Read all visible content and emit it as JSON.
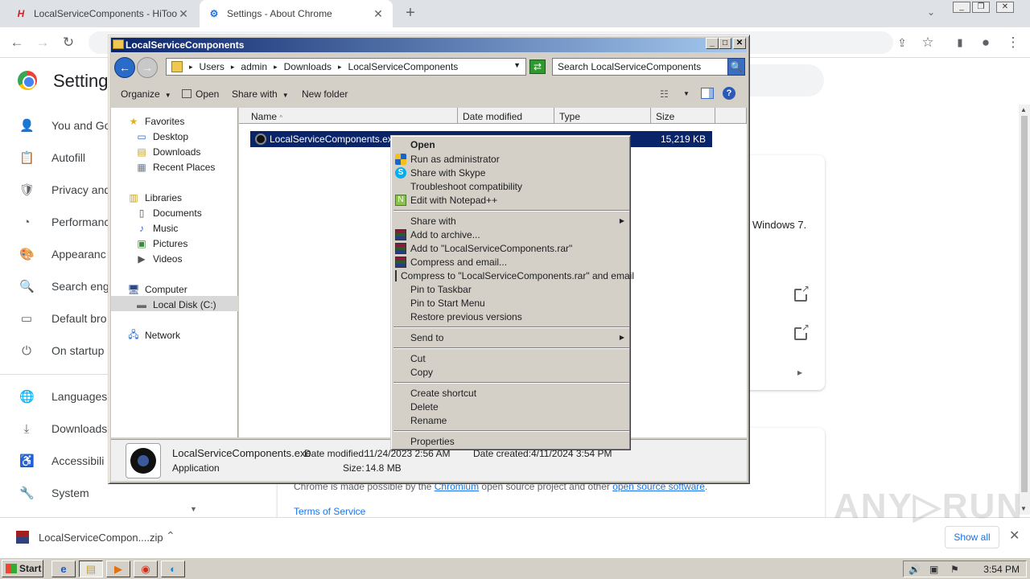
{
  "browser": {
    "tabs": [
      {
        "favicon": "H",
        "title": "LocalServiceComponents - HiTools - H",
        "close": "✕"
      },
      {
        "favicon": "⚙",
        "title": "Settings - About Chrome",
        "close": "✕"
      }
    ],
    "new_tab": "+",
    "tab_search": "⌄",
    "window_controls": [
      "_",
      "❐",
      "✕"
    ],
    "toolbar": {
      "back": "←",
      "forward": "→",
      "reload": "↻",
      "share": "⇪",
      "star": "☆",
      "sidebar": "▮",
      "profile": "●",
      "menu": "⋮"
    }
  },
  "settings": {
    "title": "Settings",
    "nav": [
      {
        "icon": "person-icon",
        "glyph": "👤",
        "label": "You and Go"
      },
      {
        "icon": "autofill-icon",
        "glyph": "📋",
        "label": "Autofill"
      },
      {
        "icon": "shield-icon",
        "glyph": "🛡",
        "label": "Privacy and"
      },
      {
        "icon": "gauge-icon",
        "glyph": "◔",
        "label": "Performanc"
      },
      {
        "icon": "palette-icon",
        "glyph": "🎨",
        "label": "Appearanc"
      },
      {
        "icon": "search-icon",
        "glyph": "🔍",
        "label": "Search eng"
      },
      {
        "icon": "browser-icon",
        "glyph": "▭",
        "label": "Default bro"
      },
      {
        "icon": "power-icon",
        "glyph": "⏻",
        "label": "On startup"
      },
      {
        "icon": "globe-icon",
        "glyph": "🌐",
        "label": "Languages"
      },
      {
        "icon": "download-icon",
        "glyph": "⤓",
        "label": "Downloads"
      },
      {
        "icon": "accessibility-icon",
        "glyph": "♿",
        "label": "Accessibili"
      },
      {
        "icon": "wrench-icon",
        "glyph": "🔧",
        "label": "System"
      }
    ],
    "nav_scroll_arrow": "▼",
    "about_partial": "Windows 7.",
    "footer_prefix": "Chrome is made possible by the ",
    "footer_link1": "Chromium",
    "footer_middle": " open source project and other ",
    "footer_link2": "open source software",
    "footer_suffix": ".",
    "terms": "Terms of Service",
    "chevron": "▸"
  },
  "download_bar": {
    "filename": "LocalServiceCompon....zip",
    "chevron": "⌃",
    "show_all": "Show all",
    "close": "✕"
  },
  "watermark": "ANY▷RUN",
  "explorer": {
    "title": "LocalServiceComponents",
    "window_buttons": [
      "_",
      "□",
      "✕"
    ],
    "back": "←",
    "forward": "→",
    "breadcrumb": [
      "Users",
      "admin",
      "Downloads",
      "LocalServiceComponents"
    ],
    "crumb_sep": "▸",
    "addr_dropdown": "▼",
    "refresh": "⇄",
    "search_placeholder": "Search LocalServiceComponents",
    "search_btn": "🔍",
    "commands": {
      "organize": "Organize",
      "open": "Open",
      "share_with": "Share with",
      "new_folder": "New folder",
      "dropdown": "▼",
      "help": "?"
    },
    "nav_pane": [
      {
        "icon": "star-icon",
        "glyph": "★",
        "label": "Favorites",
        "level": 0
      },
      {
        "icon": "desktop-icon",
        "glyph": "▭",
        "label": "Desktop",
        "level": 1
      },
      {
        "icon": "downloads-folder-icon",
        "glyph": "▤",
        "label": "Downloads",
        "level": 1
      },
      {
        "icon": "recent-places-icon",
        "glyph": "▦",
        "label": "Recent Places",
        "level": 1
      },
      {
        "icon": "libraries-icon",
        "glyph": "▥",
        "label": "Libraries",
        "level": 0
      },
      {
        "icon": "documents-icon",
        "glyph": "▯",
        "label": "Documents",
        "level": 1
      },
      {
        "icon": "music-icon",
        "glyph": "♪",
        "label": "Music",
        "level": 1
      },
      {
        "icon": "pictures-icon",
        "glyph": "▣",
        "label": "Pictures",
        "level": 1
      },
      {
        "icon": "videos-icon",
        "glyph": "▶",
        "label": "Videos",
        "level": 1
      },
      {
        "icon": "computer-icon",
        "glyph": "🖥",
        "label": "Computer",
        "level": 0
      },
      {
        "icon": "disk-icon",
        "glyph": "▬",
        "label": "Local Disk (C:)",
        "level": 1
      },
      {
        "icon": "network-icon",
        "glyph": "🖧",
        "label": "Network",
        "level": 0
      }
    ],
    "columns": [
      "Name",
      "Date modified",
      "Type",
      "Size"
    ],
    "sort_indicator": "^",
    "file": {
      "name": "LocalServiceComponents.exe",
      "size": "15,219 KB"
    },
    "details": {
      "name": "LocalServiceComponents.exe",
      "type": "Application",
      "date_modified_label": "Date modified:",
      "date_modified": "11/24/2023 2:56 AM",
      "size_label": "Size:",
      "size": "14.8 MB",
      "date_created_label": "Date created:",
      "date_created": "4/11/2024 3:54 PM"
    }
  },
  "context_menu": {
    "groups": [
      [
        {
          "label": "Open",
          "icon": "",
          "bold": true
        },
        {
          "label": "Run as administrator",
          "icon": "uac-shield-icon"
        },
        {
          "label": "Share with Skype",
          "icon": "skype-icon"
        },
        {
          "label": "Troubleshoot compatibility",
          "icon": ""
        },
        {
          "label": "Edit with Notepad++",
          "icon": "notepadpp-icon"
        }
      ],
      [
        {
          "label": "Share with",
          "icon": "",
          "submenu": true
        },
        {
          "label": "Add to archive...",
          "icon": "winrar-icon"
        },
        {
          "label": "Add to \"LocalServiceComponents.rar\"",
          "icon": "winrar-icon"
        },
        {
          "label": "Compress and email...",
          "icon": "winrar-icon"
        },
        {
          "label": "Compress to \"LocalServiceComponents.rar\" and email",
          "icon": "winrar-icon"
        },
        {
          "label": "Pin to Taskbar",
          "icon": ""
        },
        {
          "label": "Pin to Start Menu",
          "icon": ""
        },
        {
          "label": "Restore previous versions",
          "icon": ""
        }
      ],
      [
        {
          "label": "Send to",
          "icon": "",
          "submenu": true
        }
      ],
      [
        {
          "label": "Cut",
          "icon": ""
        },
        {
          "label": "Copy",
          "icon": ""
        }
      ],
      [
        {
          "label": "Create shortcut",
          "icon": ""
        },
        {
          "label": "Delete",
          "icon": ""
        },
        {
          "label": "Rename",
          "icon": ""
        }
      ],
      [
        {
          "label": "Properties",
          "icon": ""
        }
      ]
    ],
    "submenu_arrow": "▶"
  },
  "taskbar": {
    "start": "Start",
    "apps": [
      {
        "icon": "ie-icon",
        "glyph": "e"
      },
      {
        "icon": "explorer-folder-icon",
        "glyph": "▤",
        "active": true
      },
      {
        "icon": "media-player-icon",
        "glyph": "▶"
      },
      {
        "icon": "chrome-icon",
        "glyph": "◉"
      },
      {
        "icon": "edge-icon",
        "glyph": "◐"
      }
    ],
    "tray_icons": [
      "🔊",
      "▣",
      "⚑"
    ],
    "clock": "3:54 PM"
  }
}
